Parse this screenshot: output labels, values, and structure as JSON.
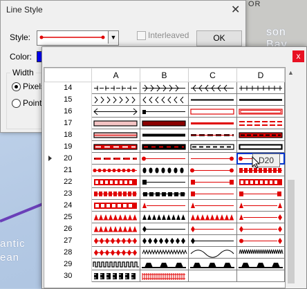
{
  "map": {
    "labels": [
      "son Bay",
      "OR",
      "antic",
      "ean"
    ]
  },
  "line_style_dialog": {
    "title": "Line Style",
    "close_glyph": "✕",
    "style_label": "Style:",
    "interleaved_label": "Interleaved",
    "ok_label": "OK",
    "color_label": "Color:",
    "width_group_label": "Width",
    "pixels_label": "Pixels",
    "points_label": "Points",
    "selected_width_unit": "Pixels"
  },
  "palette": {
    "close_glyph": "x",
    "columns": [
      "A",
      "B",
      "C",
      "D"
    ],
    "rows": [
      "14",
      "15",
      "16",
      "17",
      "18",
      "19",
      "20",
      "21",
      "22",
      "23",
      "24",
      "25",
      "26",
      "27",
      "28",
      "29",
      "30"
    ],
    "current_row": "20",
    "selected_cell": "D20",
    "tooltip": "D20"
  },
  "colors": {
    "line_red": "#e00000",
    "selection_blue": "#0033cc",
    "close_red": "#e81123"
  }
}
